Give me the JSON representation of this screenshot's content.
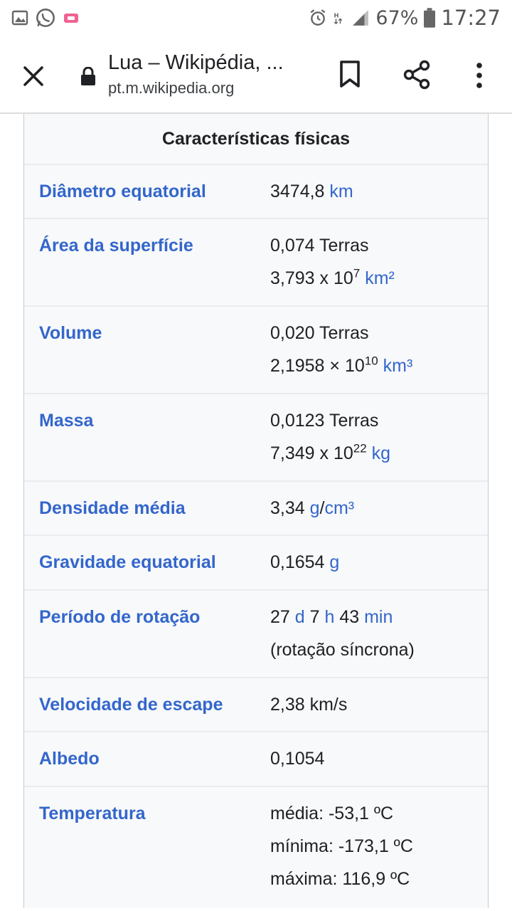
{
  "status_bar": {
    "battery": "67%",
    "time": "17:27"
  },
  "browser": {
    "title": "Lua – Wikipédia, ...",
    "url": "pt.m.wikipedia.org"
  },
  "infobox": {
    "header": "Características físicas",
    "rows": {
      "diametro": {
        "label": "Diâmetro equatorial",
        "value": "3474,8",
        "unit": "km"
      },
      "area": {
        "label": "Área da superfície",
        "line1": "0,074 Terras",
        "base": "3,793 x 10",
        "exp": "7",
        "unit": "km²"
      },
      "volume": {
        "label": "Volume",
        "line1": "0,020 Terras",
        "base": "2,1958 × 10",
        "exp": "10",
        "unit": "km³"
      },
      "massa": {
        "label": "Massa",
        "line1": "0,0123 Terras",
        "base": "7,349 x 10",
        "exp": "22",
        "unit": "kg"
      },
      "densidade": {
        "label": "Densidade média",
        "value": "3,34",
        "unit_a": "g",
        "sep": "/",
        "unit_b": "cm³"
      },
      "gravidade": {
        "label": "Gravidade equatorial",
        "value": "0,1654",
        "unit": "g"
      },
      "rotacao": {
        "label": "Período de rotação",
        "d_val": "27",
        "d_unit": "d",
        "h_val": "7",
        "h_unit": "h",
        "m_val": "43",
        "m_unit": "min",
        "line2": "(rotação síncrona)"
      },
      "escape": {
        "label": "Velocidade de escape",
        "value": "2,38 km/s"
      },
      "albedo": {
        "label": "Albedo",
        "value": "0,1054"
      },
      "temperatura": {
        "label": "Temperatura",
        "media": "média: -53,1 ºC",
        "minima": "mínima: -173,1 ºC",
        "maxima": "máxima: 116,9 ºC"
      }
    }
  },
  "icons": [
    "gallery-icon",
    "whatsapp-icon",
    "notification-icon",
    "alarm-icon",
    "data-icon",
    "signal-icon",
    "battery-icon",
    "close-icon",
    "lock-icon",
    "bookmark-icon",
    "share-icon",
    "more-icon"
  ],
  "colors": {
    "link": "#3366cc",
    "infobox_bg": "#f8f9fa",
    "border": "#eaecf0"
  }
}
